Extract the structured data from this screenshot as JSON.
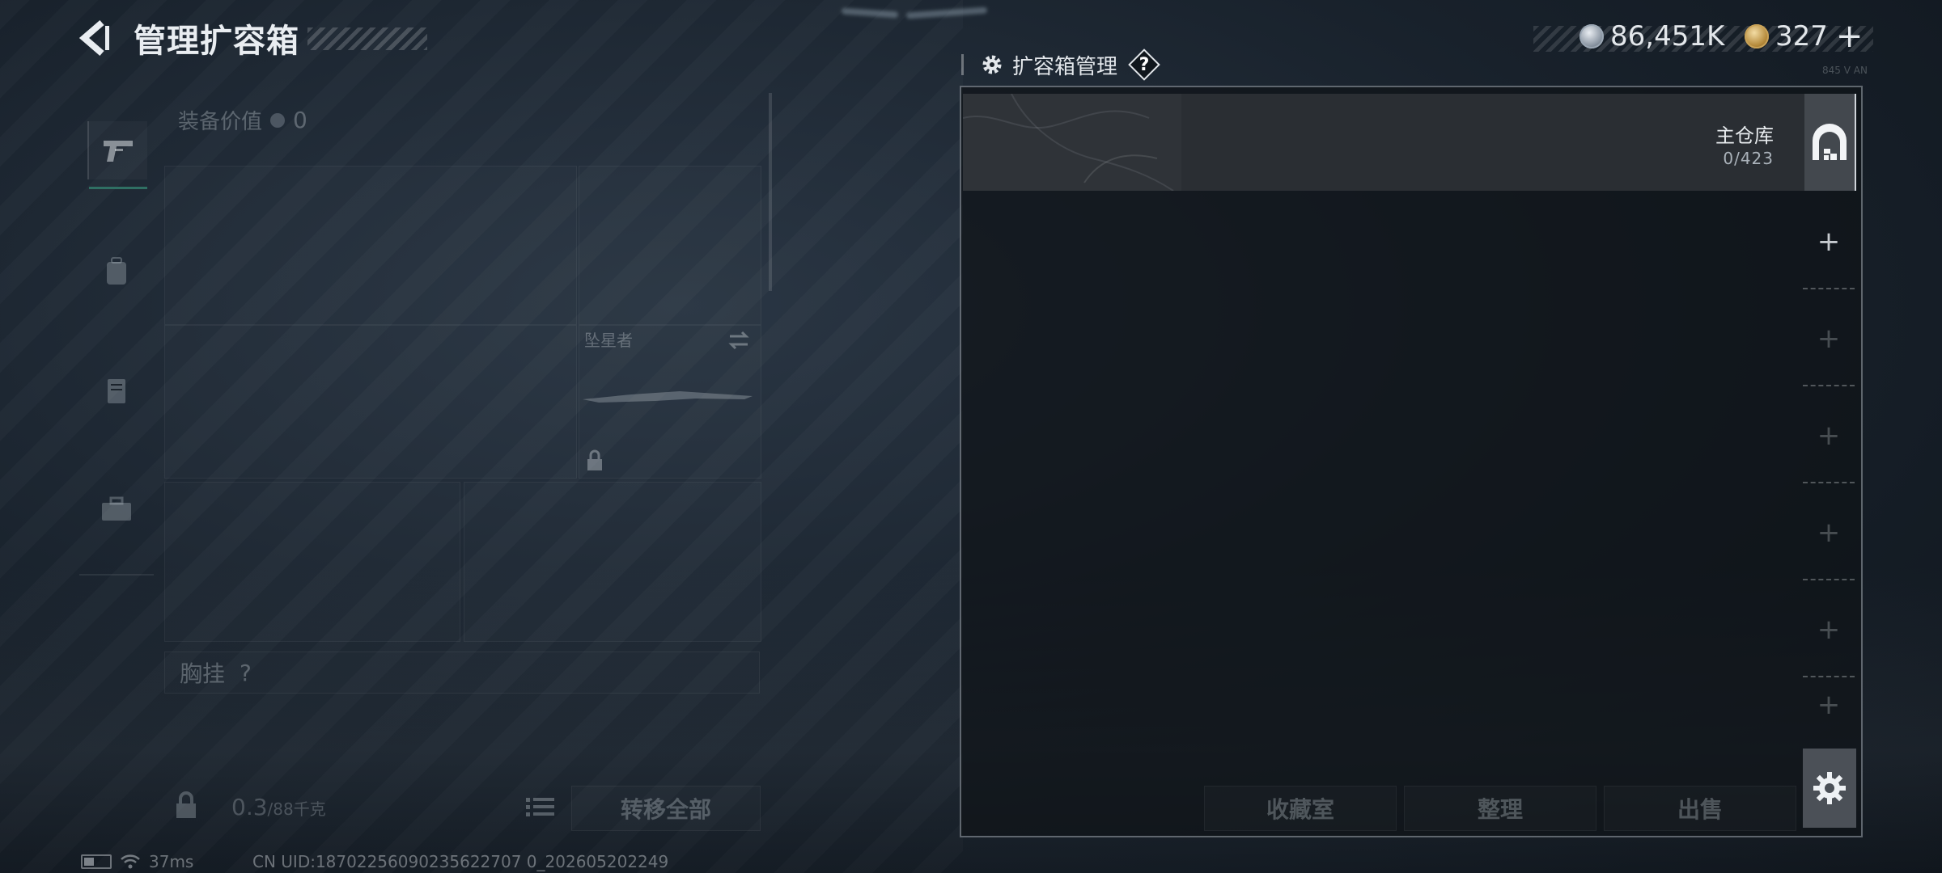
{
  "header": {
    "title": "管理扩容箱"
  },
  "currency": {
    "silver_amount": "86,451K",
    "gold_amount": "327",
    "gold_add": "+"
  },
  "left_panel": {
    "equipment_value_label": "装备价值",
    "equipment_value": "0",
    "weapon_name": "坠星者",
    "chest_rig_label": "胸挂",
    "chest_rig_help": "?",
    "weight_value": "0.3",
    "weight_max": "/88",
    "weight_unit": "千克",
    "transfer_all_label": "转移全部"
  },
  "status": {
    "ping": "37ms",
    "uid": "CN UID:18702256090235622707 0_202605202249"
  },
  "right_panel": {
    "title": "扩容箱管理",
    "help": "?",
    "tag": "845 V AN",
    "warehouse_name": "主仓库",
    "warehouse_count": "0/423",
    "add_slots": [
      "+",
      "+",
      "+",
      "+",
      "+",
      "+"
    ],
    "buttons": {
      "collection_room": "收藏室",
      "organize": "整理",
      "sell": "出售"
    }
  },
  "icons": {
    "back": "chevron-left-icon",
    "settings": "gear-icon",
    "pistol": "pistol-icon",
    "backpack": "backpack-icon",
    "vest": "vest-icon",
    "toolbox": "toolbox-icon",
    "lock": "lock-icon",
    "list": "list-icon",
    "warehouse": "warehouse-icon",
    "wifi": "wifi-icon",
    "battery": "battery-icon"
  }
}
